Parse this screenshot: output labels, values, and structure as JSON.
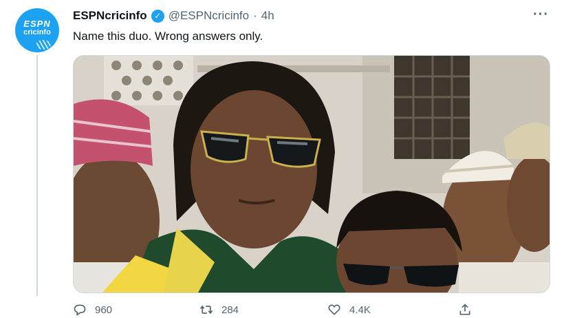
{
  "tweet": {
    "avatar": {
      "logo_top": "ESPN",
      "logo_bottom": "cricinfo",
      "color": "#1da1f2"
    },
    "display_name": "ESPNcricinfo",
    "verified_icon": "verified-badge-icon",
    "handle": "@ESPNcricinfo",
    "separator": "·",
    "time": "4h",
    "more_icon": "more-options-icon",
    "text": "Name this duo. Wrong answers only.",
    "photo_icon": "photo-of-two-men-in-sunglasses"
  },
  "actions": {
    "reply": {
      "icon": "reply-icon",
      "count": "960"
    },
    "retweet": {
      "icon": "retweet-icon",
      "count": "284"
    },
    "like": {
      "icon": "heart-icon",
      "count": "4.4K"
    },
    "share": {
      "icon": "share-icon"
    }
  },
  "colors": {
    "text": "#0f1419",
    "muted": "#536471",
    "accent": "#1da1f2",
    "border": "#cfd9de"
  }
}
